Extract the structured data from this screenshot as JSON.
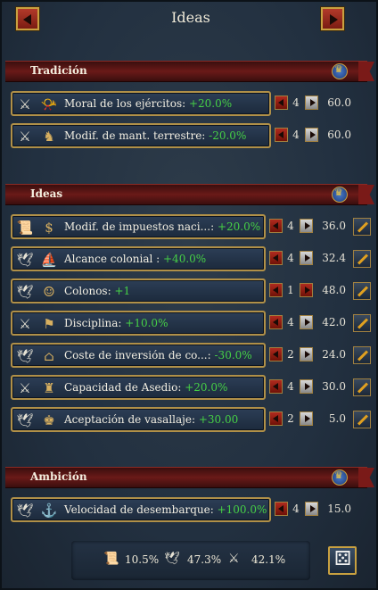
{
  "window": {
    "title": "Ideas"
  },
  "tradition": {
    "title": "Tradición",
    "rows": [
      {
        "name": "Moral de los ejércitos:",
        "value": "+20.0%",
        "value_color": "#46d046",
        "level": "4",
        "cost": "60.0",
        "category_icon": "crossed-swords-icon",
        "idea_icon": "trumpet-icon"
      },
      {
        "name": "Modif. de mant. terrestre:",
        "value": "-20.0%",
        "value_color": "#46d046",
        "level": "4",
        "cost": "60.0",
        "category_icon": "crossed-swords-icon",
        "idea_icon": "soldier-icon"
      }
    ]
  },
  "ideas": {
    "title": "Ideas",
    "rows": [
      {
        "name": "Modif. de impuestos naci...:",
        "value": "+20.0%",
        "value_color": "#46d046",
        "level": "4",
        "cost": "36.0",
        "category_icon": "scroll-icon",
        "idea_icon": "coins-icon"
      },
      {
        "name": "Alcance colonial :",
        "value": "+40.0%",
        "value_color": "#46d046",
        "level": "4",
        "cost": "32.4",
        "category_icon": "dove-icon",
        "idea_icon": "ship-icon"
      },
      {
        "name": "Colonos:",
        "value": "+1",
        "value_color": "#46d046",
        "level": "1",
        "cost": "48.0",
        "category_icon": "dove-icon",
        "idea_icon": "colonist-icon",
        "plus_red": true
      },
      {
        "name": "Disciplina:",
        "value": "+10.0%",
        "value_color": "#46d046",
        "level": "4",
        "cost": "42.0",
        "category_icon": "crossed-swords-icon",
        "idea_icon": "drill-icon"
      },
      {
        "name": "Coste de inversión de co...:",
        "value": "-30.0%",
        "value_color": "#46d046",
        "level": "2",
        "cost": "24.0",
        "category_icon": "dove-icon",
        "idea_icon": "building-icon"
      },
      {
        "name": "Capacidad de Asedio:",
        "value": "+20.0%",
        "value_color": "#46d046",
        "level": "4",
        "cost": "30.0",
        "category_icon": "crossed-swords-icon",
        "idea_icon": "castle-icon"
      },
      {
        "name": "Aceptación de vasallaje:",
        "value": "+30.00",
        "value_color": "#46d046",
        "level": "2",
        "cost": "5.0",
        "category_icon": "dove-icon",
        "idea_icon": "vassal-icon"
      }
    ]
  },
  "ambition": {
    "title": "Ambición",
    "rows": [
      {
        "name": "Velocidad de desembarque:",
        "value": "+100.0%",
        "value_color": "#46d046",
        "level": "4",
        "cost": "15.0",
        "category_icon": "dove-icon",
        "idea_icon": "landing-icon"
      }
    ]
  },
  "footer": {
    "admin_pct": "10.5%",
    "diplo_pct": "47.3%",
    "military_pct": "42.1%"
  },
  "colors": {
    "positive": "#46d046",
    "gold": "#c8a040",
    "ribbon": "#6a1a18"
  }
}
